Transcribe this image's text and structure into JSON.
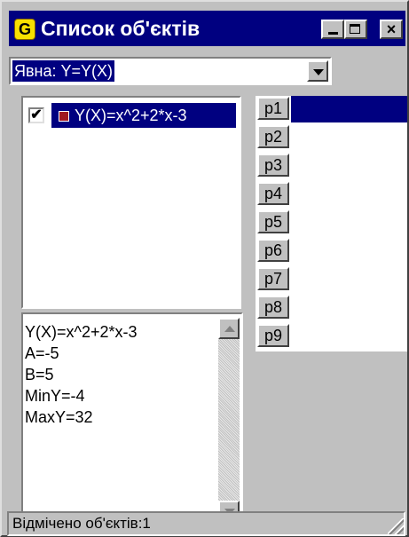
{
  "window": {
    "title": "Список об'єктів",
    "icon": "G"
  },
  "combo": {
    "value": "Явна: Y=Y(X)"
  },
  "objects": [
    {
      "label": "Y(X)=x^2+2*x-3",
      "checked": true,
      "color": "#a01820",
      "selected": true
    }
  ],
  "properties": [
    "Y(X)=x^2+2*x-3",
    "A=-5",
    "B=5",
    "MinY=-4",
    "MaxY=32"
  ],
  "points": [
    {
      "label": "p1",
      "selected": true
    },
    {
      "label": "p2"
    },
    {
      "label": "p3"
    },
    {
      "label": "p4"
    },
    {
      "label": "p5"
    },
    {
      "label": "p6"
    },
    {
      "label": "p7"
    },
    {
      "label": "p8"
    },
    {
      "label": "p9"
    }
  ],
  "status": {
    "text": "Відмічено об'єктів:1"
  },
  "colors": {
    "selection": "#000080",
    "face": "#c0c0c0"
  }
}
